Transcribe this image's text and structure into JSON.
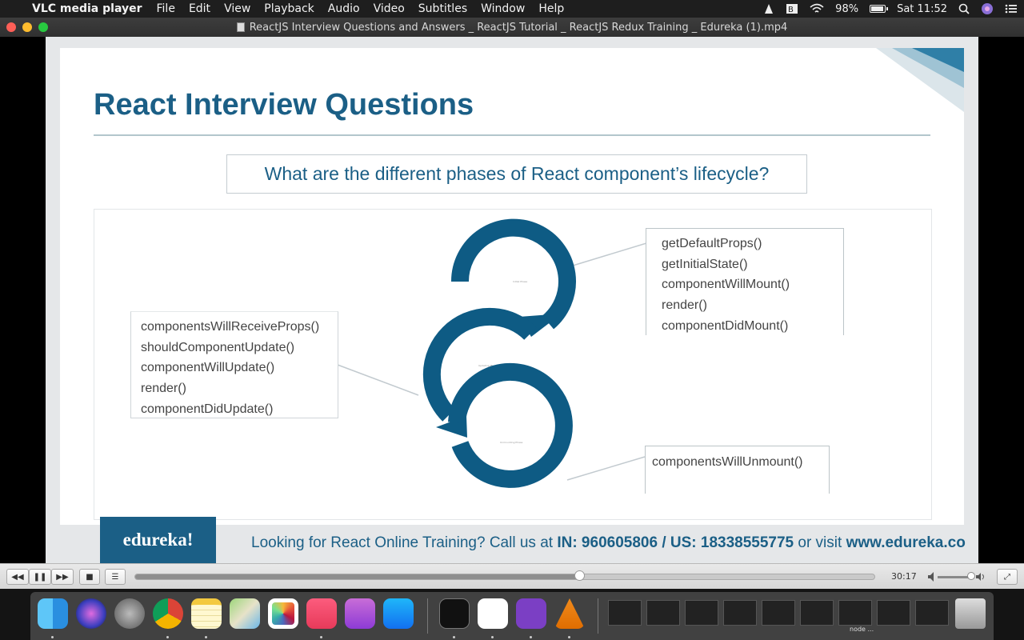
{
  "menubar": {
    "app_name": "VLC media player",
    "menus": [
      "File",
      "Edit",
      "View",
      "Playback",
      "Audio",
      "Video",
      "Subtitles",
      "Window",
      "Help"
    ],
    "battery_percent": "98%",
    "battery_level": 0.98,
    "clock": "Sat 11:52"
  },
  "window": {
    "title": "ReactJS Interview Questions and Answers _ ReactJS Tutorial _ ReactJS Redux Training _ Edureka (1).mp4"
  },
  "slide": {
    "title": "React Interview Questions",
    "question": "What are the different phases of React component’s lifecycle?",
    "phase_labels": [
      "Initial Phase",
      "Updating Phase",
      "Unmounting Phase"
    ],
    "initial_methods": [
      "getDefaultProps()",
      "getInitialState()",
      "componentWillMount()",
      "render()",
      "componentDidMount()"
    ],
    "updating_methods": [
      "componentsWillReceiveProps()",
      "shouldComponentUpdate()",
      "componentWillUpdate()",
      "render()",
      "componentDidUpdate()"
    ],
    "unmounting_methods": [
      "componentsWillUnmount()"
    ],
    "colors": {
      "primary": "#1b5f86",
      "arc": "#0e5b84"
    }
  },
  "footer": {
    "logo": "edureka!",
    "text_prefix": "Looking for React Online Training? Call us at ",
    "phones": "IN: 960605806 / US: 18338555775",
    "text_mid": " or visit ",
    "site": "www.edureka.co"
  },
  "controls": {
    "rewind_icon": "◀◀",
    "pause_icon": "❚❚",
    "forward_icon": "▶▶",
    "stop_icon": "■",
    "playlist_icon": "☰",
    "fullscreen_icon": "⤢",
    "time": "30:17",
    "progress": 0.6,
    "volume": 0.95
  },
  "dock": {
    "apps": [
      "finder-icon",
      "siri-icon",
      "launchpad-icon",
      "chrome-icon",
      "notes-icon",
      "maps-icon",
      "photos-icon",
      "music-icon",
      "podcasts-icon",
      "appstore-icon",
      "terminal-icon",
      "vscode-icon",
      "github-desktop-icon",
      "vlc-icon"
    ],
    "window_label": "node ..."
  }
}
